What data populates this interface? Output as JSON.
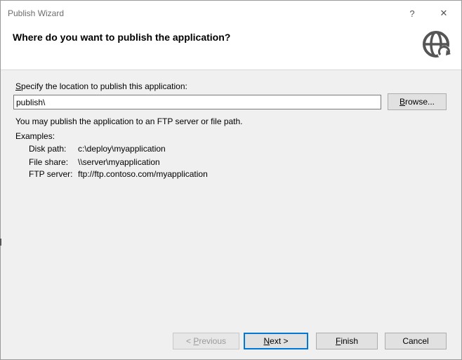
{
  "window": {
    "title": "Publish Wizard",
    "help_glyph": "?",
    "close_glyph": "✕"
  },
  "header": {
    "title": "Where do you want to publish the application?",
    "icon": "globe-publish-icon"
  },
  "location": {
    "prompt_prefix": "S",
    "prompt_rest": "pecify the location to publish this application:",
    "value": "publish\\",
    "browse_prefix": "B",
    "browse_rest": "rowse..."
  },
  "info": {
    "hint": "You may publish the application to an FTP server or file path.",
    "examples_heading": "Examples:",
    "examples": [
      {
        "label": "Disk path:",
        "value": "c:\\deploy\\myapplication"
      },
      {
        "label": "File share:",
        "value": "\\\\server\\myapplication"
      },
      {
        "label": "FTP server:",
        "value": "ftp://ftp.contoso.com/myapplication"
      }
    ]
  },
  "footer": {
    "previous_prefix": "< ",
    "previous_accel": "P",
    "previous_rest": "revious",
    "next_accel": "N",
    "next_rest": "ext >",
    "finish_accel": "F",
    "finish_rest": "inish",
    "cancel_label": "Cancel"
  },
  "colors": {
    "accent": "#0078d7",
    "icon": "#555555"
  }
}
